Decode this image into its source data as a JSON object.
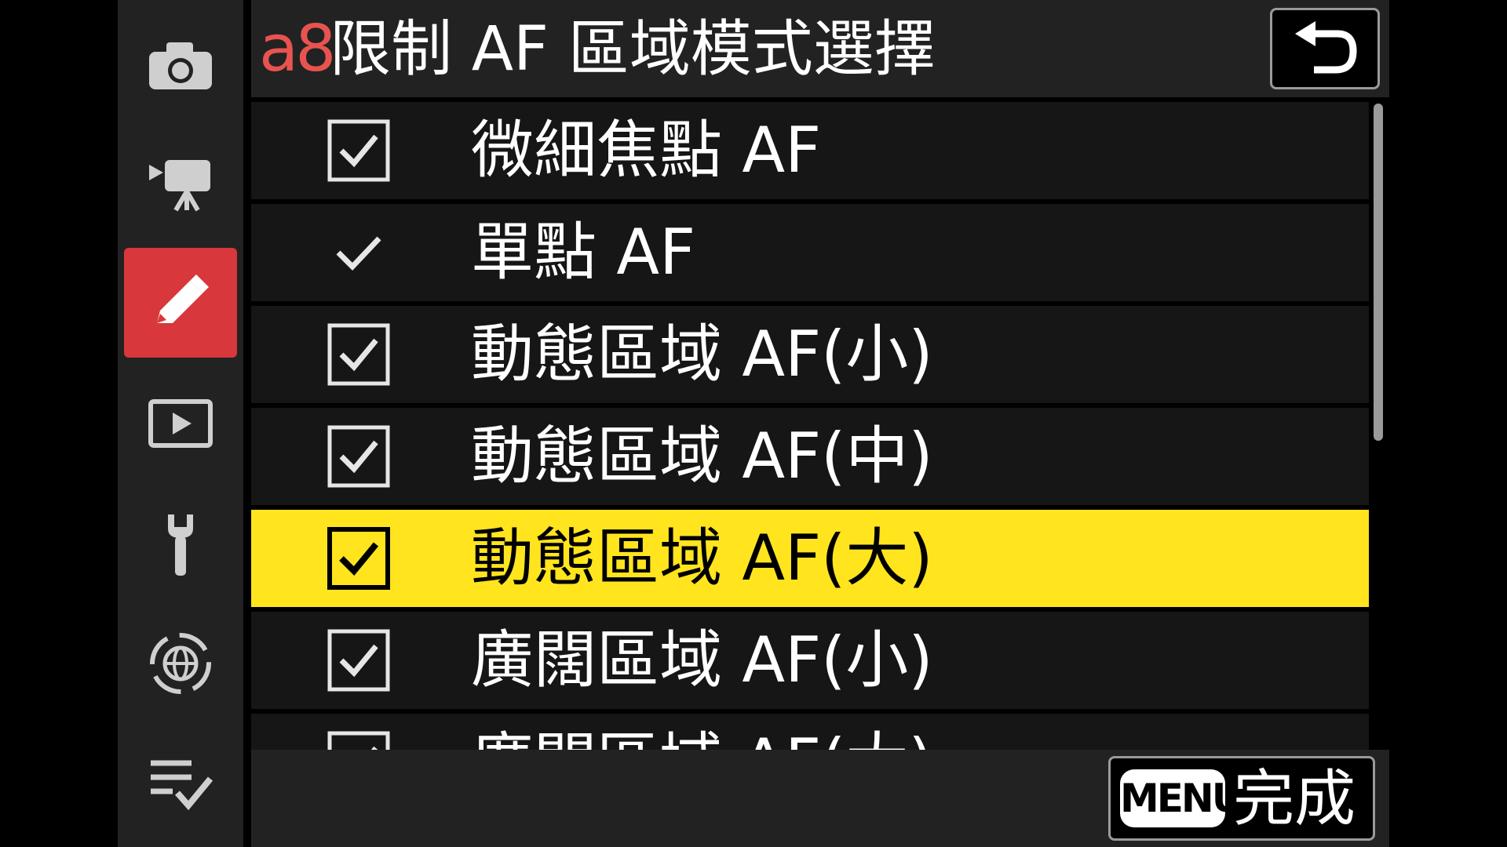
{
  "header": {
    "menu_code": "a8",
    "title": "限制 AF 區域模式選擇"
  },
  "sidebar": {
    "items": [
      {
        "icon": "camera-icon",
        "active": false
      },
      {
        "icon": "video-camera-icon",
        "active": false
      },
      {
        "icon": "pencil-icon",
        "active": true
      },
      {
        "icon": "playback-icon",
        "active": false
      },
      {
        "icon": "wrench-icon",
        "active": false
      },
      {
        "icon": "network-icon",
        "active": false
      },
      {
        "icon": "my-menu-icon",
        "active": false
      }
    ]
  },
  "list": {
    "items": [
      {
        "label": "微細焦點 AF",
        "check": "checkbox"
      },
      {
        "label": "單點 AF",
        "check": "fixed-check"
      },
      {
        "label": "動態區域 AF(小)",
        "check": "checkbox"
      },
      {
        "label": "動態區域 AF(中)",
        "check": "checkbox"
      },
      {
        "label": "動態區域 AF(大)",
        "check": "checkbox",
        "selected": true
      },
      {
        "label": "廣闊區域 AF(小)",
        "check": "checkbox"
      },
      {
        "label": "廣闊區域 AF(大)",
        "check": "checkbox"
      }
    ]
  },
  "footer": {
    "menu_key": "MENU",
    "done_label": "完成"
  },
  "colors": {
    "accent_red": "#d8373b",
    "menu_code_red": "#e8534f",
    "highlight_yellow": "#ffe41e",
    "panel_bg": "#222222",
    "row_bg": "#161616"
  }
}
